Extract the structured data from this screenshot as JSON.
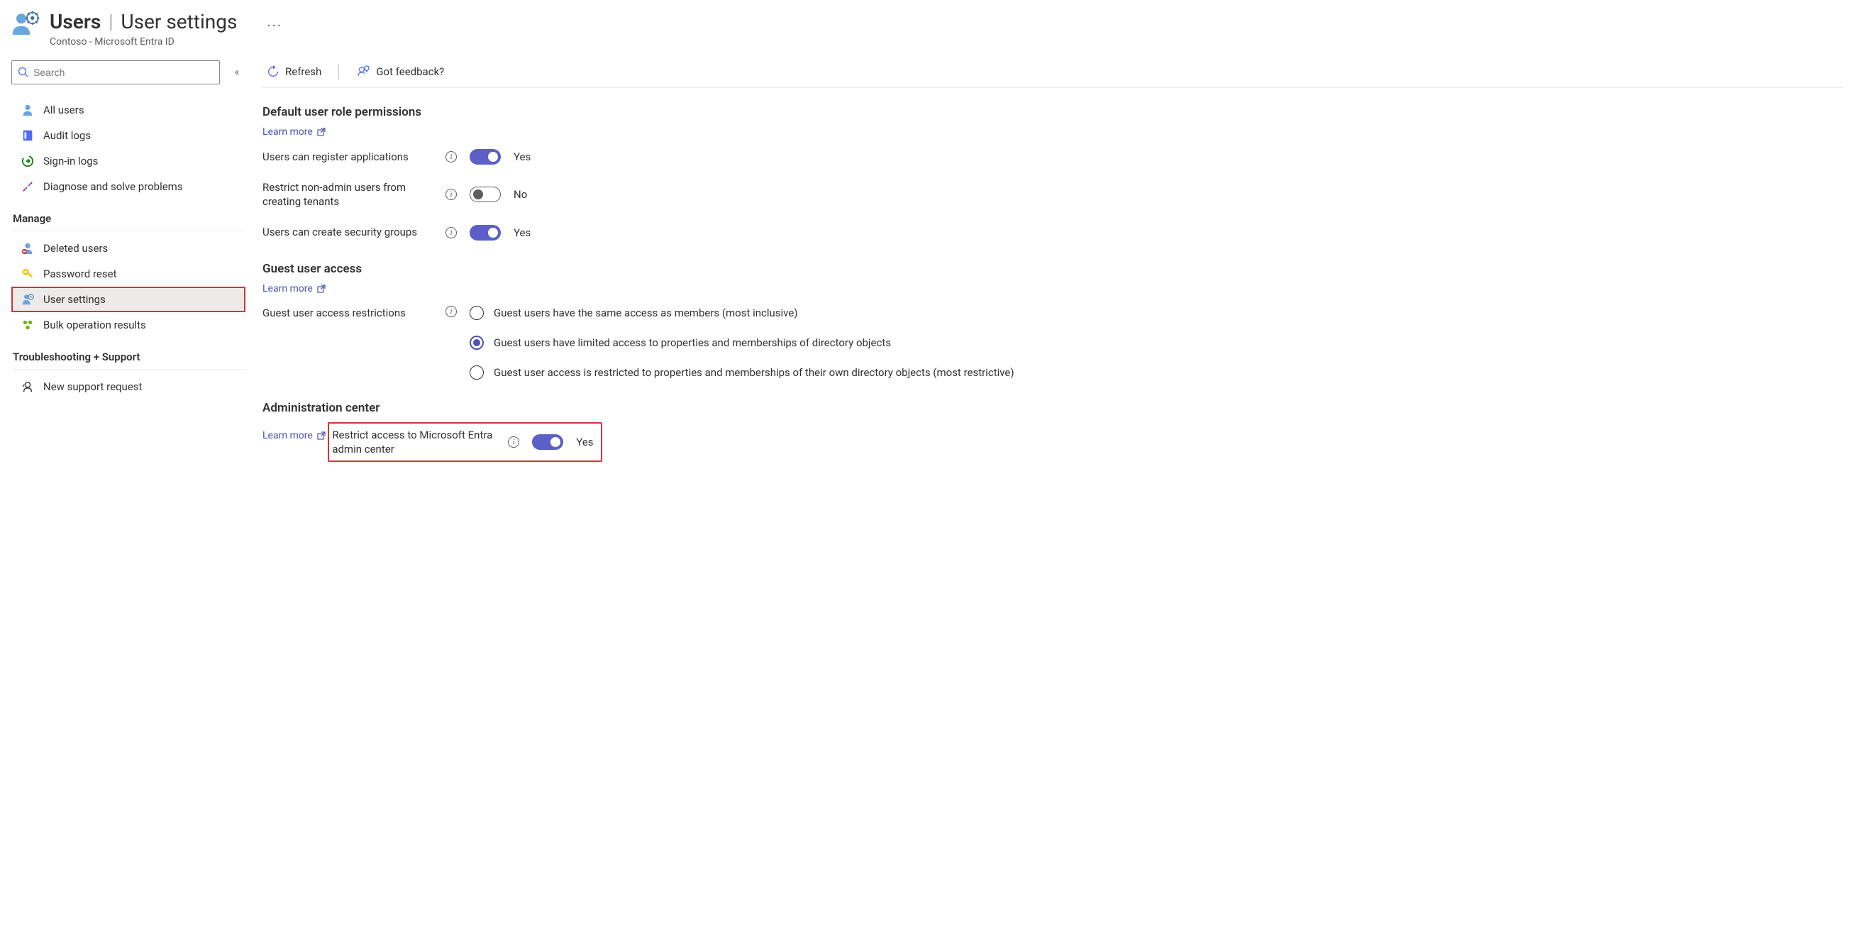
{
  "header": {
    "title_bold": "Users",
    "title_sep": "|",
    "title_rest": "User settings",
    "subtitle": "Contoso - Microsoft Entra ID",
    "more": "···"
  },
  "sidebar": {
    "search_placeholder": "Search",
    "collapse_glyph": "«",
    "items_top": [
      {
        "label": "All users"
      },
      {
        "label": "Audit logs"
      },
      {
        "label": "Sign-in logs"
      },
      {
        "label": "Diagnose and solve problems"
      }
    ],
    "section_manage": "Manage",
    "items_manage": [
      {
        "label": "Deleted users"
      },
      {
        "label": "Password reset"
      },
      {
        "label": "User settings"
      },
      {
        "label": "Bulk operation results"
      }
    ],
    "section_support": "Troubleshooting + Support",
    "items_support": [
      {
        "label": "New support request"
      }
    ]
  },
  "toolbar": {
    "refresh": "Refresh",
    "feedback": "Got feedback?"
  },
  "sections": {
    "default_perms": {
      "title": "Default user role permissions",
      "learn_more": "Learn more",
      "rows": [
        {
          "label": "Users can register applications",
          "state": "on",
          "value": "Yes"
        },
        {
          "label": "Restrict non-admin users from creating tenants",
          "state": "off",
          "value": "No"
        },
        {
          "label": "Users can create security groups",
          "state": "on",
          "value": "Yes"
        }
      ]
    },
    "guest": {
      "title": "Guest user access",
      "learn_more": "Learn more",
      "row_label": "Guest user access restrictions",
      "options": [
        "Guest users have the same access as members (most inclusive)",
        "Guest users have limited access to properties and memberships of directory objects",
        "Guest user access is restricted to properties and memberships of their own directory objects (most restrictive)"
      ],
      "selected_index": 1
    },
    "admin": {
      "title": "Administration center",
      "learn_more": "Learn more",
      "row": {
        "label": "Restrict access to Microsoft Entra admin center",
        "state": "on",
        "value": "Yes"
      }
    }
  }
}
